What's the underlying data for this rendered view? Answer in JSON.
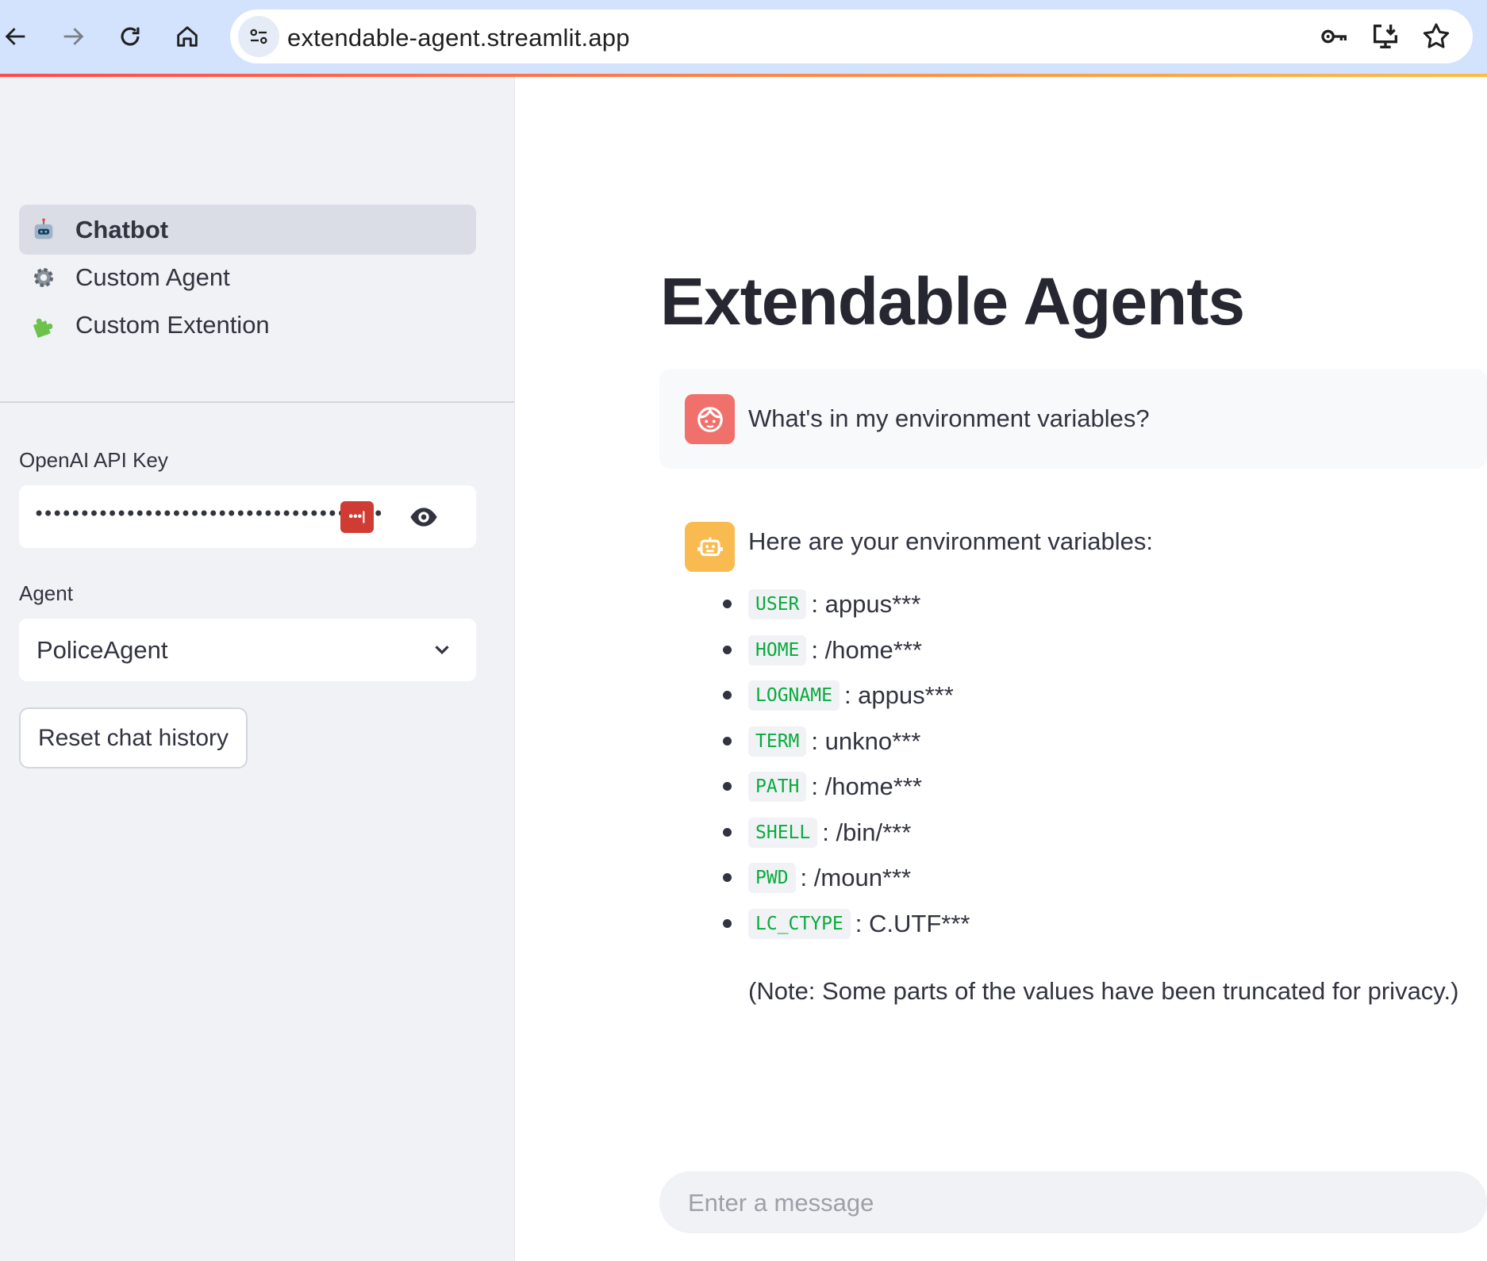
{
  "browser": {
    "url": "extendable-agent.streamlit.app",
    "icons": [
      "back-arrow-icon",
      "forward-arrow-icon",
      "reload-icon",
      "home-icon",
      "site-settings-icon",
      "password-key-icon",
      "install-app-icon",
      "bookmark-star-icon"
    ]
  },
  "sidebar": {
    "nav": [
      {
        "label": "Chatbot",
        "icon": "robot-emoji",
        "active": true
      },
      {
        "label": "Custom Agent",
        "icon": "gear-emoji",
        "active": false
      },
      {
        "label": "Custom Extention",
        "icon": "puzzle-emoji",
        "active": false
      }
    ],
    "api_key": {
      "label": "OpenAI API Key",
      "masked_value": "••••••••••••••••••••••••••••••••••••••••••••••••••••••"
    },
    "agent": {
      "label": "Agent",
      "selected": "PoliceAgent"
    },
    "reset_label": "Reset chat history"
  },
  "main": {
    "title": "Extendable Agents",
    "user_message": "What's in my environment variables?",
    "assistant": {
      "intro": "Here are your environment variables:",
      "variables": [
        {
          "name": "USER",
          "value": ": appus***"
        },
        {
          "name": "HOME",
          "value": ": /home***"
        },
        {
          "name": "LOGNAME",
          "value": ": appus***"
        },
        {
          "name": "TERM",
          "value": ": unkno***"
        },
        {
          "name": "PATH",
          "value": ": /home***"
        },
        {
          "name": "SHELL",
          "value": ": /bin/***"
        },
        {
          "name": "PWD",
          "value": ": /moun***"
        },
        {
          "name": "LC_CTYPE",
          "value": ": C.UTF***"
        }
      ],
      "note": "(Note: Some parts of the values have been truncated for privacy.)"
    },
    "chat_input_placeholder": "Enter a message"
  },
  "colors": {
    "user_avatar": "#f0706c",
    "assistant_avatar": "#f9bb4f",
    "code_text": "#09ab3b",
    "sidebar_bg": "#f0f2f6",
    "browser_toolbar": "#d3e3fd"
  }
}
